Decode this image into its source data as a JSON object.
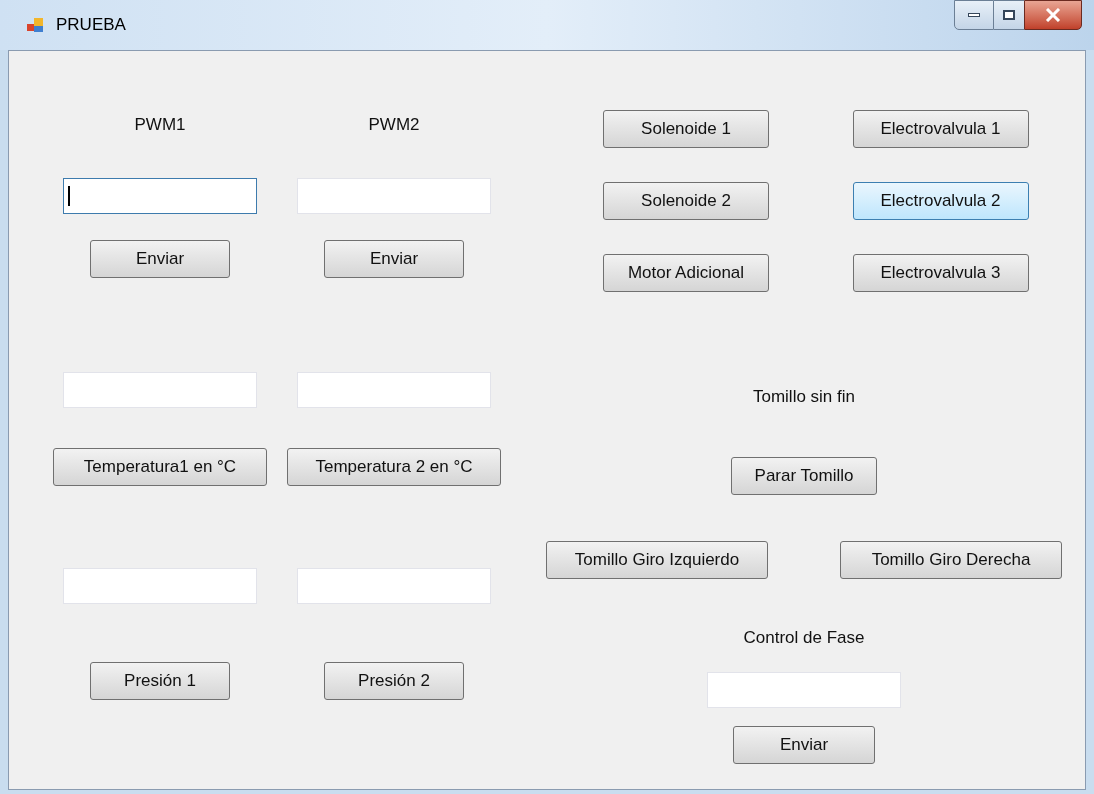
{
  "window": {
    "title": "PRUEBA"
  },
  "columns": [
    {
      "heading": "PWM1",
      "fields": [
        {
          "focused": true
        },
        {
          "focused": false
        },
        {
          "focused": false
        }
      ],
      "buttons": [
        {
          "label": "Enviar",
          "hovered": false
        },
        {
          "label": "Temperatura1 en °C",
          "hovered": false
        },
        {
          "label": "Presión 1",
          "hovered": false
        }
      ]
    },
    {
      "heading": "PWM2",
      "fields": [
        {
          "focused": false
        },
        {
          "focused": false
        },
        {
          "focused": false
        }
      ],
      "buttons": [
        {
          "label": "Enviar",
          "hovered": false
        },
        {
          "label": "Temperatura 2 en °C",
          "hovered": false
        },
        {
          "label": "Presión 2",
          "hovered": false
        }
      ]
    }
  ],
  "actuator_buttons": [
    {
      "label": "Solenoide 1",
      "hovered": false
    },
    {
      "label": "Electrovalvula 1",
      "hovered": false
    },
    {
      "label": "Solenoide 2",
      "hovered": false
    },
    {
      "label": "Electrovalvula 2",
      "hovered": true
    },
    {
      "label": "Motor Adicional",
      "hovered": false
    },
    {
      "label": "Electrovalvula 3",
      "hovered": false
    }
  ],
  "screw": {
    "heading": "Tomillo sin fin",
    "stop_button": {
      "label": "Parar Tomillo",
      "hovered": false
    },
    "direction_buttons": [
      {
        "label": "Tomillo Giro Izquierdo",
        "hovered": false
      },
      {
        "label": "Tomillo Giro Derecha",
        "hovered": false
      }
    ]
  },
  "phase_control": {
    "heading": "Control de Fase",
    "field": {
      "focused": false
    },
    "send_button": {
      "label": "Enviar",
      "hovered": false
    }
  }
}
